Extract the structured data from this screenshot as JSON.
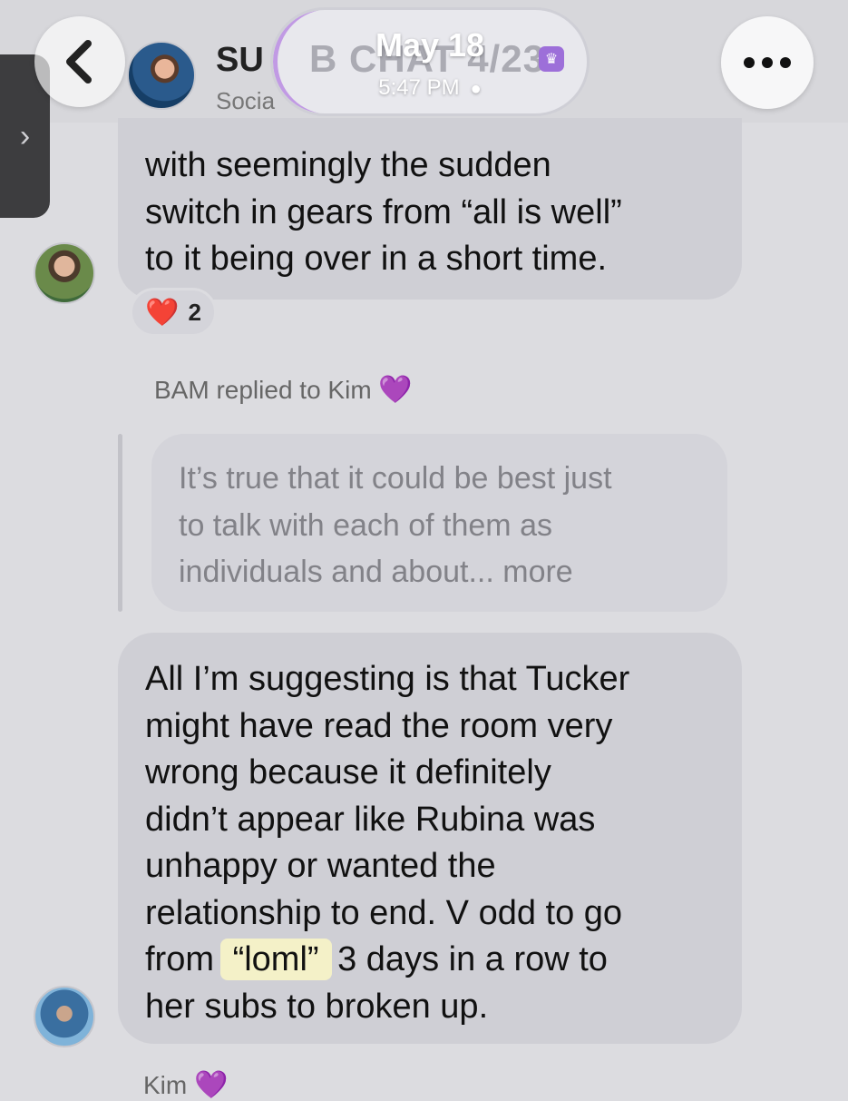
{
  "header": {
    "chat_name": "SU",
    "subtitle": "Socia",
    "pill_ghost_text": "B CHAT 4/23",
    "date": "May 18",
    "time": "5:47 PM"
  },
  "icons": {
    "back": "chevron-left-icon",
    "more": "ellipsis-icon",
    "side_tab": "chevron-right-icon",
    "person": "person-icon",
    "crown": "crown-icon"
  },
  "messages": [
    {
      "text": "with seemingly the sudden\nswitch in gears from “all is well”\nto it being over in a short time.",
      "reaction": {
        "emoji": "❤️",
        "count": "2"
      }
    },
    {
      "reply_label": "BAM replied to Kim",
      "reply_emoji": "💜",
      "quoted_text": "It’s true that it could be best just\nto talk with each of them as\nindividuals and about... more",
      "text_before": "All I’m suggesting is that Tucker\nmight have read the room very\nwrong because it definitely\ndidn’t appear like Rubina was\nunhappy or wanted the\nrelationship to end.  V odd to go\nfrom ",
      "highlight": "“loml”",
      "text_after": " 3 days in a row to\nher subs to broken up."
    }
  ],
  "next_sender": "Kim",
  "next_sender_emoji": "💜",
  "colors": {
    "background": "#dcdce0",
    "bubble": "#cfcfd5",
    "highlight": "#f4f1c8",
    "accent_purple": "#9d6fd9",
    "reaction_heart": "#e02020"
  }
}
